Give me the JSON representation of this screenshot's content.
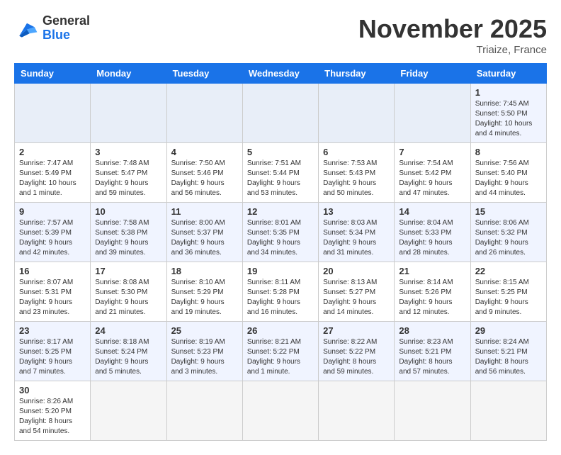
{
  "logo": {
    "line1": "General",
    "line2": "Blue"
  },
  "title": "November 2025",
  "subtitle": "Triaize, France",
  "days_header": [
    "Sunday",
    "Monday",
    "Tuesday",
    "Wednesday",
    "Thursday",
    "Friday",
    "Saturday"
  ],
  "weeks": [
    [
      {
        "day": "",
        "info": ""
      },
      {
        "day": "",
        "info": ""
      },
      {
        "day": "",
        "info": ""
      },
      {
        "day": "",
        "info": ""
      },
      {
        "day": "",
        "info": ""
      },
      {
        "day": "",
        "info": ""
      },
      {
        "day": "1",
        "info": "Sunrise: 7:45 AM\nSunset: 5:50 PM\nDaylight: 10 hours and 4 minutes."
      }
    ],
    [
      {
        "day": "2",
        "info": "Sunrise: 7:47 AM\nSunset: 5:49 PM\nDaylight: 10 hours and 1 minute."
      },
      {
        "day": "3",
        "info": "Sunrise: 7:48 AM\nSunset: 5:47 PM\nDaylight: 9 hours and 59 minutes."
      },
      {
        "day": "4",
        "info": "Sunrise: 7:50 AM\nSunset: 5:46 PM\nDaylight: 9 hours and 56 minutes."
      },
      {
        "day": "5",
        "info": "Sunrise: 7:51 AM\nSunset: 5:44 PM\nDaylight: 9 hours and 53 minutes."
      },
      {
        "day": "6",
        "info": "Sunrise: 7:53 AM\nSunset: 5:43 PM\nDaylight: 9 hours and 50 minutes."
      },
      {
        "day": "7",
        "info": "Sunrise: 7:54 AM\nSunset: 5:42 PM\nDaylight: 9 hours and 47 minutes."
      },
      {
        "day": "8",
        "info": "Sunrise: 7:56 AM\nSunset: 5:40 PM\nDaylight: 9 hours and 44 minutes."
      }
    ],
    [
      {
        "day": "9",
        "info": "Sunrise: 7:57 AM\nSunset: 5:39 PM\nDaylight: 9 hours and 42 minutes."
      },
      {
        "day": "10",
        "info": "Sunrise: 7:58 AM\nSunset: 5:38 PM\nDaylight: 9 hours and 39 minutes."
      },
      {
        "day": "11",
        "info": "Sunrise: 8:00 AM\nSunset: 5:37 PM\nDaylight: 9 hours and 36 minutes."
      },
      {
        "day": "12",
        "info": "Sunrise: 8:01 AM\nSunset: 5:35 PM\nDaylight: 9 hours and 34 minutes."
      },
      {
        "day": "13",
        "info": "Sunrise: 8:03 AM\nSunset: 5:34 PM\nDaylight: 9 hours and 31 minutes."
      },
      {
        "day": "14",
        "info": "Sunrise: 8:04 AM\nSunset: 5:33 PM\nDaylight: 9 hours and 28 minutes."
      },
      {
        "day": "15",
        "info": "Sunrise: 8:06 AM\nSunset: 5:32 PM\nDaylight: 9 hours and 26 minutes."
      }
    ],
    [
      {
        "day": "16",
        "info": "Sunrise: 8:07 AM\nSunset: 5:31 PM\nDaylight: 9 hours and 23 minutes."
      },
      {
        "day": "17",
        "info": "Sunrise: 8:08 AM\nSunset: 5:30 PM\nDaylight: 9 hours and 21 minutes."
      },
      {
        "day": "18",
        "info": "Sunrise: 8:10 AM\nSunset: 5:29 PM\nDaylight: 9 hours and 19 minutes."
      },
      {
        "day": "19",
        "info": "Sunrise: 8:11 AM\nSunset: 5:28 PM\nDaylight: 9 hours and 16 minutes."
      },
      {
        "day": "20",
        "info": "Sunrise: 8:13 AM\nSunset: 5:27 PM\nDaylight: 9 hours and 14 minutes."
      },
      {
        "day": "21",
        "info": "Sunrise: 8:14 AM\nSunset: 5:26 PM\nDaylight: 9 hours and 12 minutes."
      },
      {
        "day": "22",
        "info": "Sunrise: 8:15 AM\nSunset: 5:25 PM\nDaylight: 9 hours and 9 minutes."
      }
    ],
    [
      {
        "day": "23",
        "info": "Sunrise: 8:17 AM\nSunset: 5:25 PM\nDaylight: 9 hours and 7 minutes."
      },
      {
        "day": "24",
        "info": "Sunrise: 8:18 AM\nSunset: 5:24 PM\nDaylight: 9 hours and 5 minutes."
      },
      {
        "day": "25",
        "info": "Sunrise: 8:19 AM\nSunset: 5:23 PM\nDaylight: 9 hours and 3 minutes."
      },
      {
        "day": "26",
        "info": "Sunrise: 8:21 AM\nSunset: 5:22 PM\nDaylight: 9 hours and 1 minute."
      },
      {
        "day": "27",
        "info": "Sunrise: 8:22 AM\nSunset: 5:22 PM\nDaylight: 8 hours and 59 minutes."
      },
      {
        "day": "28",
        "info": "Sunrise: 8:23 AM\nSunset: 5:21 PM\nDaylight: 8 hours and 57 minutes."
      },
      {
        "day": "29",
        "info": "Sunrise: 8:24 AM\nSunset: 5:21 PM\nDaylight: 8 hours and 56 minutes."
      }
    ],
    [
      {
        "day": "30",
        "info": "Sunrise: 8:26 AM\nSunset: 5:20 PM\nDaylight: 8 hours and 54 minutes."
      },
      {
        "day": "",
        "info": ""
      },
      {
        "day": "",
        "info": ""
      },
      {
        "day": "",
        "info": ""
      },
      {
        "day": "",
        "info": ""
      },
      {
        "day": "",
        "info": ""
      },
      {
        "day": "",
        "info": ""
      }
    ]
  ]
}
